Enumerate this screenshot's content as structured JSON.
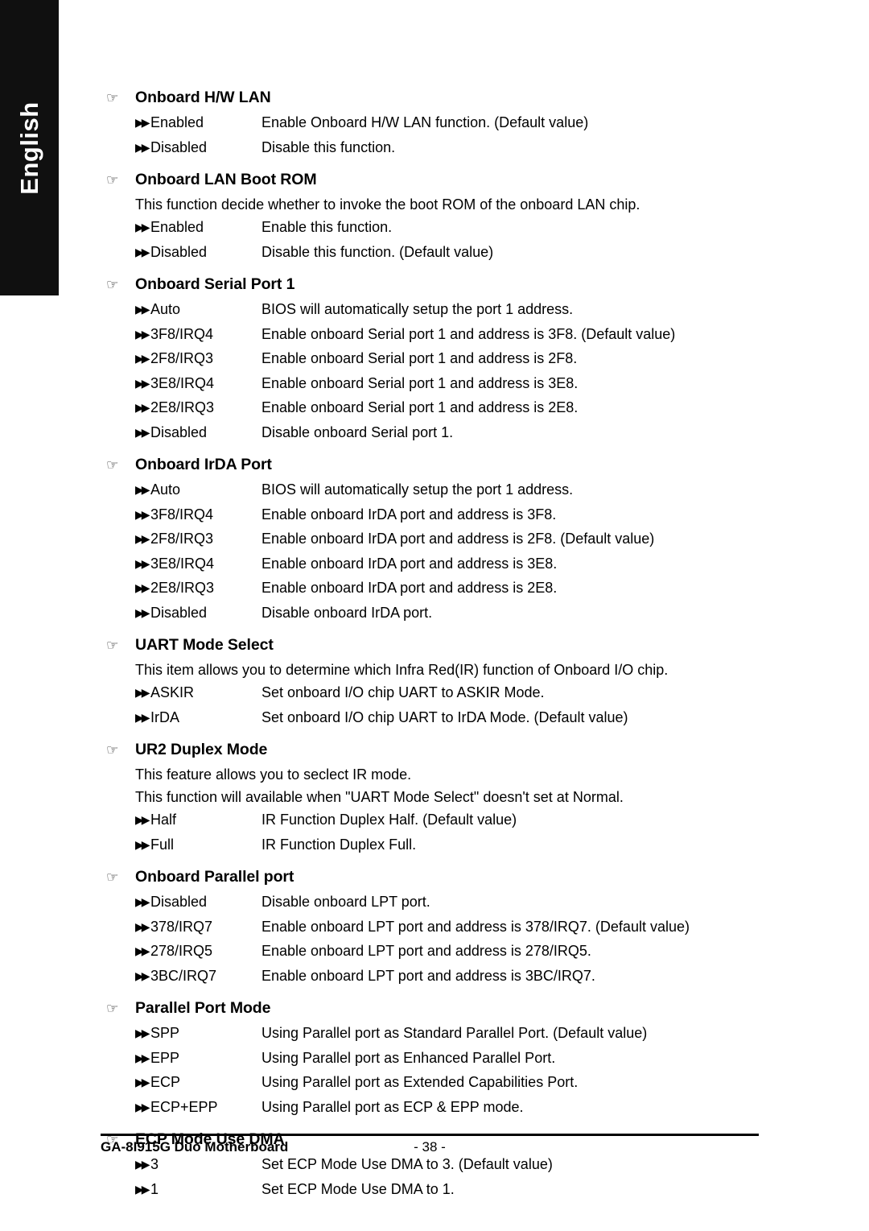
{
  "language_tab": {
    "label": "English"
  },
  "icons": {
    "section_marker": "pointing-hand-icon",
    "option_marker": "double-triangle-icon",
    "section_glyph": "☞",
    "option_glyph": "▶▶"
  },
  "sections": [
    {
      "title": "Onboard H/W LAN",
      "notes": [],
      "options": [
        {
          "label": "Enabled",
          "desc": "Enable Onboard H/W LAN function. (Default value)"
        },
        {
          "label": "Disabled",
          "desc": "Disable this function."
        }
      ]
    },
    {
      "title": "Onboard LAN Boot ROM",
      "notes": [
        "This function decide whether to invoke the boot ROM of the onboard LAN chip."
      ],
      "options": [
        {
          "label": "Enabled",
          "desc": "Enable this function."
        },
        {
          "label": "Disabled",
          "desc": "Disable this function. (Default value)"
        }
      ]
    },
    {
      "title": "Onboard Serial Port 1",
      "notes": [],
      "options": [
        {
          "label": "Auto",
          "desc": "BIOS will automatically setup the port 1 address."
        },
        {
          "label": "3F8/IRQ4",
          "desc": "Enable onboard Serial port 1 and address is 3F8. (Default value)"
        },
        {
          "label": "2F8/IRQ3",
          "desc": "Enable onboard Serial port 1 and address is 2F8."
        },
        {
          "label": "3E8/IRQ4",
          "desc": "Enable onboard Serial port 1 and address is 3E8."
        },
        {
          "label": "2E8/IRQ3",
          "desc": "Enable onboard Serial port 1 and address is 2E8."
        },
        {
          "label": "Disabled",
          "desc": "Disable onboard Serial port 1."
        }
      ]
    },
    {
      "title": "Onboard IrDA Port",
      "notes": [],
      "options": [
        {
          "label": "Auto",
          "desc": "BIOS will automatically setup the port 1 address."
        },
        {
          "label": "3F8/IRQ4",
          "desc": "Enable onboard IrDA port and address is 3F8."
        },
        {
          "label": "2F8/IRQ3",
          "desc": "Enable onboard IrDA port and address is 2F8. (Default value)"
        },
        {
          "label": "3E8/IRQ4",
          "desc": "Enable onboard IrDA port and address is 3E8."
        },
        {
          "label": "2E8/IRQ3",
          "desc": "Enable onboard IrDA port and address is 2E8."
        },
        {
          "label": "Disabled",
          "desc": "Disable onboard IrDA port."
        }
      ]
    },
    {
      "title": "UART Mode Select",
      "notes": [
        "This item allows you to determine which Infra Red(IR) function of Onboard I/O chip."
      ],
      "options": [
        {
          "label": "ASKIR",
          "desc": "Set onboard I/O chip UART to ASKIR Mode."
        },
        {
          "label": "IrDA",
          "desc": "Set onboard I/O chip UART to IrDA Mode. (Default value)"
        }
      ]
    },
    {
      "title": "UR2 Duplex Mode",
      "notes": [
        "This feature allows you to seclect IR mode.",
        "This function will available when \"UART Mode Select\" doesn't set at Normal."
      ],
      "options": [
        {
          "label": "Half",
          "desc": "IR Function Duplex Half. (Default value)"
        },
        {
          "label": "Full",
          "desc": "IR Function Duplex Full."
        }
      ]
    },
    {
      "title": "Onboard Parallel port",
      "notes": [],
      "options": [
        {
          "label": "Disabled",
          "desc": "Disable onboard LPT port."
        },
        {
          "label": "378/IRQ7",
          "desc": "Enable onboard LPT port and address is 378/IRQ7. (Default value)"
        },
        {
          "label": "278/IRQ5",
          "desc": "Enable onboard LPT port and address is 278/IRQ5."
        },
        {
          "label": "3BC/IRQ7",
          "desc": "Enable onboard LPT port and address is 3BC/IRQ7."
        }
      ]
    },
    {
      "title": "Parallel Port Mode",
      "notes": [],
      "options": [
        {
          "label": "SPP",
          "desc": "Using Parallel port as Standard Parallel Port. (Default value)"
        },
        {
          "label": "EPP",
          "desc": "Using Parallel port as Enhanced Parallel Port."
        },
        {
          "label": "ECP",
          "desc": "Using Parallel port as Extended Capabilities Port."
        },
        {
          "label": "ECP+EPP",
          "desc": "Using Parallel port as ECP & EPP mode."
        }
      ]
    },
    {
      "title": "ECP Mode Use DMA",
      "notes": [],
      "options": [
        {
          "label": "3",
          "desc": "Set ECP Mode Use DMA to 3. (Default value)"
        },
        {
          "label": "1",
          "desc": "Set ECP Mode Use DMA to 1."
        }
      ]
    }
  ],
  "footer": {
    "product": "GA-8I915G Duo Motherboard",
    "page_number": "- 38 -"
  },
  "colors": {
    "tab_background": "#101010",
    "tab_text": "#ffffff",
    "page_background": "#ffffff",
    "body_text": "#000000"
  }
}
